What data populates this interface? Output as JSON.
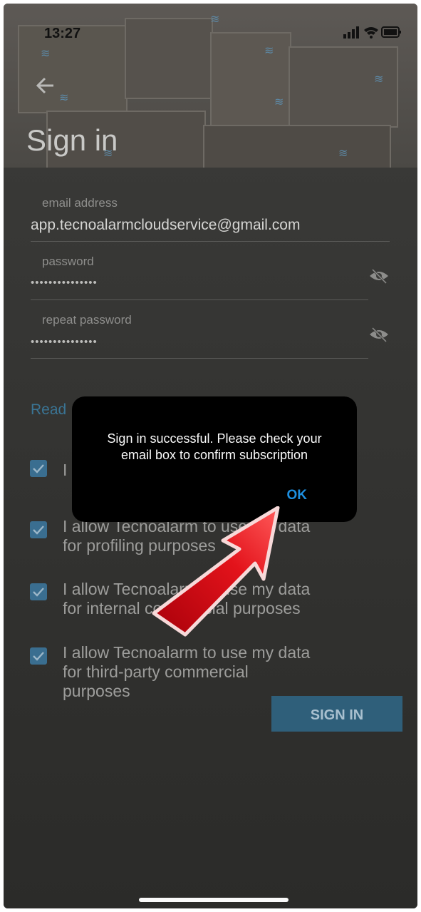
{
  "status_bar": {
    "time": "13:27"
  },
  "header": {
    "title": "Sign in"
  },
  "form": {
    "email": {
      "label": "email address",
      "value": "app.tecnoalarmcloudservice@gmail.com"
    },
    "password": {
      "label": "password",
      "value": "•••••••••••••••"
    },
    "repeat_password": {
      "label": "repeat password",
      "value": "•••••••••••••••"
    }
  },
  "read_link": "Read",
  "consents": [
    {
      "text": "I",
      "checked": true
    },
    {
      "text_line1": "I allow Tecnoalarm to use my data",
      "text_line2": "for profiling purposes",
      "checked": true
    },
    {
      "text_line1": "I allow Tecnoalarm to use my data",
      "text_line2": "for internal commercial purposes",
      "checked": true
    },
    {
      "text_line1": "I allow Tecnoalarm to use my data",
      "text_line2": "for third-party commercial",
      "text_line3": "purposes",
      "checked": true
    }
  ],
  "sign_in_button": "SIGN IN",
  "dialog": {
    "message": "Sign in successful. Please check your email box to confirm subscription",
    "ok_label": "OK"
  },
  "colors": {
    "accent": "#1d8fe0",
    "button": "#2f5f7a",
    "checkbox": "#3a6e90",
    "annotation_arrow": "#e3131b"
  }
}
